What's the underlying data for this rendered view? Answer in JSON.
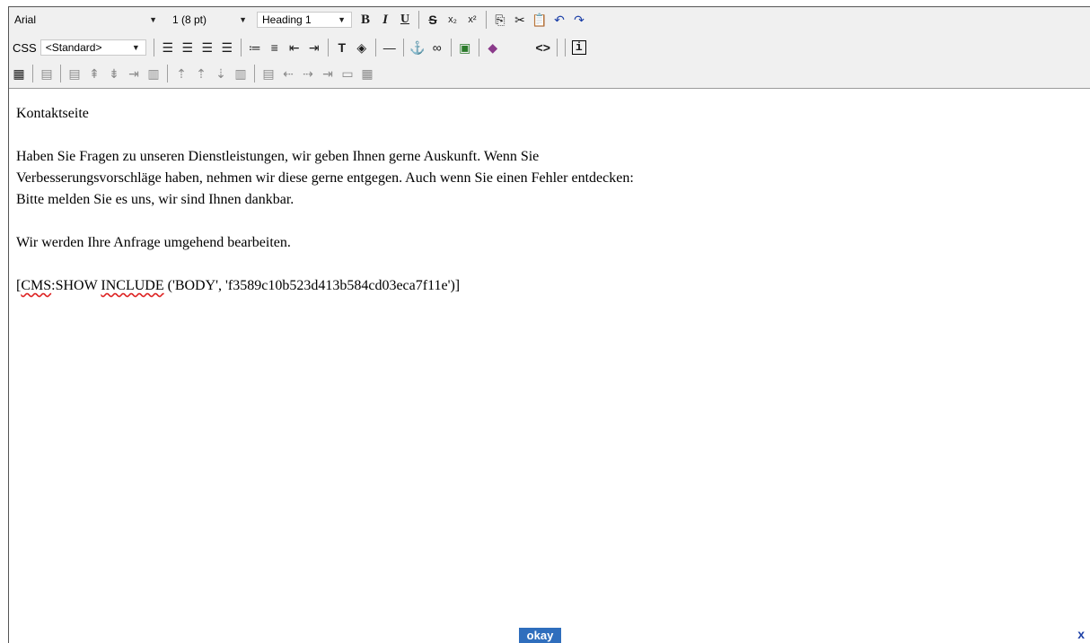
{
  "toolbar": {
    "font_family": "Arial",
    "font_size": "1 (8 pt)",
    "paragraph_format": "Heading 1",
    "css_label": "CSS",
    "css_class": "<Standard>",
    "html_icon": "<>",
    "info_icon": "i",
    "icons": {
      "bold": "B",
      "italic": "I",
      "underline": "U",
      "strikethrough": "S",
      "subscript": "x₂",
      "superscript": "x²"
    }
  },
  "content": {
    "title": "Kontaktseite",
    "paragraph1": "Haben Sie Fragen zu unseren Dienstleistungen, wir geben Ihnen gerne Auskunft. Wenn Sie Verbesserungsvorschläge haben, nehmen wir diese gerne entgegen. Auch wenn Sie einen Fehler entdecken: Bitte melden Sie es uns, wir sind Ihnen dankbar.",
    "paragraph2": "Wir werden Ihre Anfrage umgehend bearbeiten.",
    "cms_open": "[",
    "cms_word1": "CMS",
    "cms_middle": ":SHOW ",
    "cms_word2": "INCLUDE",
    "cms_rest": " ('BODY', 'f3589c10b523d413b584cd03eca7f11e')]"
  },
  "footer": {
    "okay_label": "okay",
    "close_label": "x"
  }
}
